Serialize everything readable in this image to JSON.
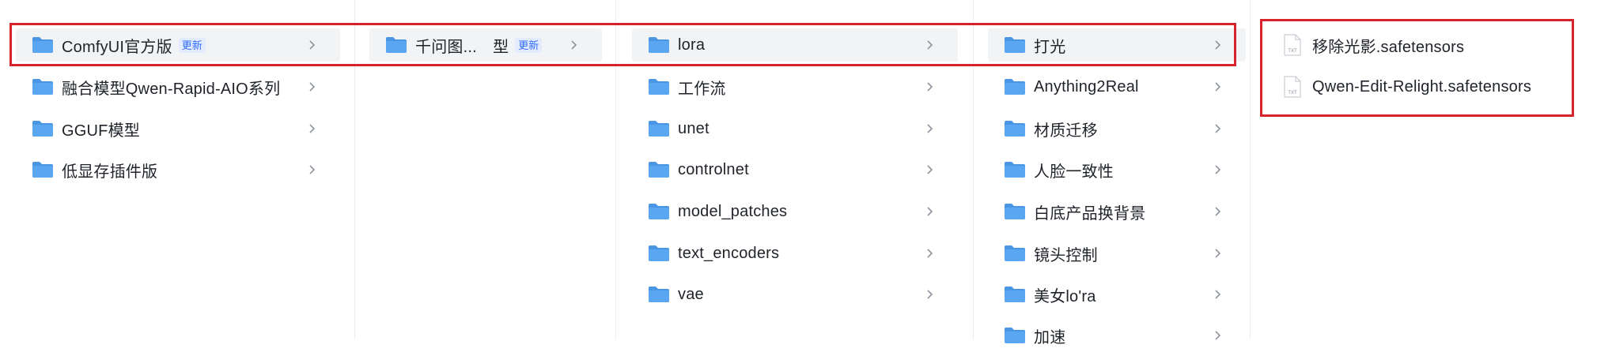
{
  "columns": [
    {
      "items": [
        {
          "label": "ComfyUI官方版",
          "badge": "更新",
          "selected": true
        },
        {
          "label": "融合模型Qwen-Rapid-AIO系列"
        },
        {
          "label": "GGUF模型"
        },
        {
          "label": "低显存插件版"
        }
      ]
    },
    {
      "items": [
        {
          "label": "千问图...　型",
          "badge": "更新",
          "selected": true
        }
      ]
    },
    {
      "items": [
        {
          "label": "lora",
          "selected": true
        },
        {
          "label": "工作流"
        },
        {
          "label": "unet"
        },
        {
          "label": "controlnet"
        },
        {
          "label": "model_patches"
        },
        {
          "label": "text_encoders"
        },
        {
          "label": "vae"
        }
      ]
    },
    {
      "items": [
        {
          "label": "打光",
          "selected": true
        },
        {
          "label": "Anything2Real"
        },
        {
          "label": "材质迁移"
        },
        {
          "label": "人脸一致性"
        },
        {
          "label": "白底产品换背景"
        },
        {
          "label": "镜头控制"
        },
        {
          "label": "美女lo'ra"
        },
        {
          "label": "加速"
        }
      ]
    }
  ],
  "files": [
    {
      "label": "移除光影.safetensors",
      "type_label": "TXT"
    },
    {
      "label": "Qwen-Edit-Relight.safetensors",
      "type_label": "TXT"
    }
  ],
  "colors": {
    "folder": "#5aa6f0",
    "folder_tab": "#4a95e4",
    "highlight": "#d6232c",
    "badge_text": "#2f6bff",
    "badge_bg": "#e3ebff",
    "selected_bg": "#f2f3f5"
  },
  "icons": {
    "folder": "folder-icon",
    "file": "txt-file-icon",
    "chevron": "chevron-right-icon"
  }
}
